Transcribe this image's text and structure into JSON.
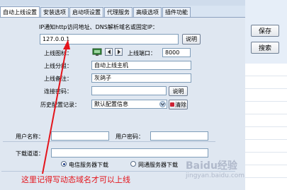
{
  "tabs": [
    {
      "label": "自动上线设置",
      "active": true
    },
    {
      "label": "安装选项",
      "active": false
    },
    {
      "label": "启动项设置",
      "active": false
    },
    {
      "label": "代理服务",
      "active": false
    },
    {
      "label": "高级选项",
      "active": false
    },
    {
      "label": "插件功能",
      "active": false
    }
  ],
  "right_panel": {
    "save_label": "保存",
    "search_label": "搜索"
  },
  "form": {
    "header_label": "IP通知http访问地址、DNS解析域名或固定IP：",
    "ip_value": "127.0.0.1",
    "explain_label": "说明",
    "domain_label": "上线图标：",
    "port_label": "上线端口：",
    "port_value": "8000",
    "group_label": "上线分组：",
    "group_value": "自动上线主机",
    "note_label": "上线备注：",
    "note_value": "灰鸽子",
    "password_label": "连接密码：",
    "password_value": "",
    "explain2_label": "说明",
    "history_label": "历史配置记录：",
    "history_value": "默认配置信息",
    "clear_label": "清除",
    "user_label": "用户名称：",
    "user_value": "",
    "userpass_label": "用户密码：",
    "userpass_value": "",
    "download_label": "下载道道：",
    "download_value": "",
    "radio_telecom": "电信服务器下载",
    "radio_netcom": "网通服务器下载"
  },
  "annotation": "这里记得写动态域名才可以上线",
  "watermark": {
    "text": "Baidu经验",
    "sub": "jingyan.baidu.com"
  },
  "colors": {
    "annotation": "#e4141b",
    "panel": "#dfe7f1",
    "tab_border": "#8da2bf"
  }
}
